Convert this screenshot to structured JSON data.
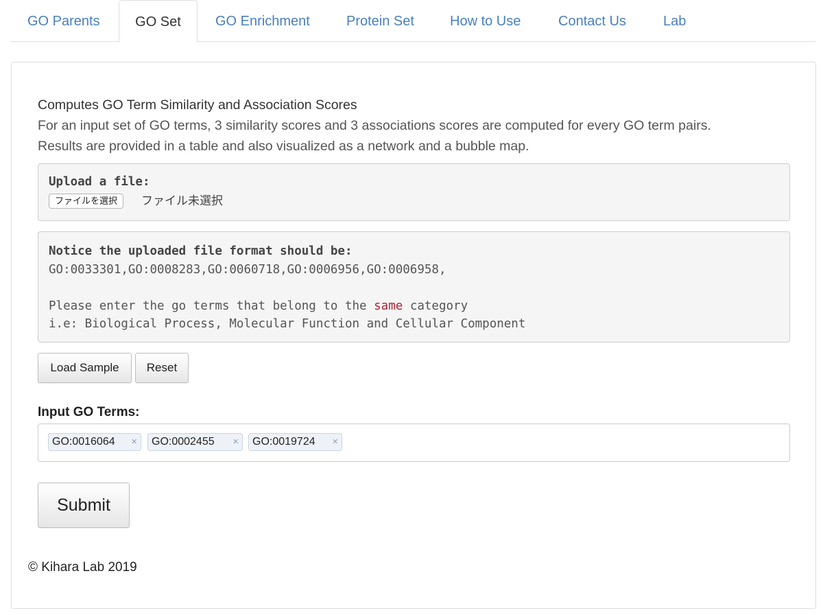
{
  "tabs": [
    {
      "label": "GO Parents",
      "active": false
    },
    {
      "label": "GO Set",
      "active": true
    },
    {
      "label": "GO Enrichment",
      "active": false
    },
    {
      "label": "Protein Set",
      "active": false
    },
    {
      "label": "How to Use",
      "active": false
    },
    {
      "label": "Contact Us",
      "active": false
    },
    {
      "label": "Lab",
      "active": false
    }
  ],
  "intro": {
    "title": "Computes GO Term Similarity and Association Scores",
    "line1": "For an input set of GO terms, 3 similarity scores and 3 associations scores are computed for every GO term pairs.",
    "line2": "Results are provided in a table and also visualized as a network and a bubble map."
  },
  "upload": {
    "label": "Upload a file:",
    "button_label": "ファイルを選択",
    "status": "ファイル未選択"
  },
  "notice": {
    "heading": "Notice the uploaded file format should be:",
    "example": "GO:0033301,GO:0008283,GO:0060718,GO:0006956,GO:0006958,",
    "instruction_prefix": "Please enter the go terms that belong to the ",
    "instruction_highlight": "same",
    "instruction_suffix": " category",
    "categories": "i.e: Biological Process, Molecular Function and Cellular Component"
  },
  "buttons": {
    "load_sample": "Load Sample",
    "reset": "Reset",
    "submit": "Submit"
  },
  "input_terms": {
    "label": "Input GO Terms:",
    "terms": [
      "GO:0016064",
      "GO:0002455",
      "GO:0019724"
    ],
    "remove_glyph": "×"
  },
  "footer": {
    "copyright": "© Kihara Lab 2019"
  },
  "colors": {
    "tab_link": "#4a80bd",
    "highlight_red": "#b22234",
    "chip_bg": "#eef2f8"
  }
}
